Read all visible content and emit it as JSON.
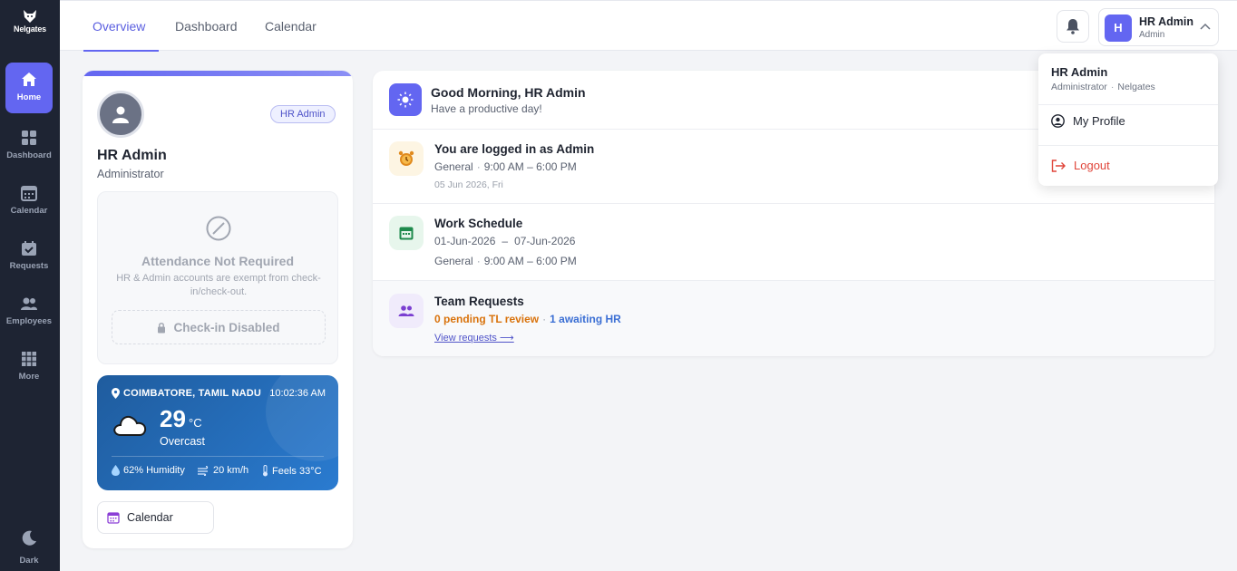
{
  "brand": {
    "name": "Nelgates"
  },
  "sidebar": {
    "items": [
      {
        "label": "Home",
        "icon": "home-icon",
        "active": true
      },
      {
        "label": "Dashboard",
        "icon": "grid-icon"
      },
      {
        "label": "Calendar",
        "icon": "calendar-icon"
      },
      {
        "label": "Requests",
        "icon": "requests-icon"
      },
      {
        "label": "Employees",
        "icon": "users-icon"
      },
      {
        "label": "More",
        "icon": "apps-icon"
      }
    ],
    "dark_label": "Dark"
  },
  "tabs": [
    {
      "label": "Overview",
      "active": true
    },
    {
      "label": "Dashboard"
    },
    {
      "label": "Calendar"
    }
  ],
  "user": {
    "initial": "H",
    "name": "HR Admin",
    "role": "Admin"
  },
  "profile": {
    "name": "HR Admin",
    "title": "Administrator",
    "badge": "HR Admin",
    "attendance_title": "Attendance Not Required",
    "attendance_desc": "HR & Admin accounts are exempt from check-in/check-out.",
    "checkin_label": "Check-in Disabled",
    "calendar_button": "Calendar"
  },
  "weather": {
    "location": "COIMBATORE, TAMIL NADU",
    "time": "10:02:36 AM",
    "temp": "29",
    "unit": "°C",
    "condition": "Overcast",
    "humidity": "62% Humidity",
    "wind": "20 km/h",
    "feels": "Feels 33°C"
  },
  "greeting": {
    "title": "Good Morning, HR Admin",
    "subtitle": "Have a productive day!"
  },
  "login": {
    "title": "You are logged in as Admin",
    "shift": "General",
    "hours": "9:00 AM – 6:00 PM",
    "date": "05 Jun 2026, Fri"
  },
  "schedule": {
    "title": "Work Schedule",
    "start": "01-Jun-2026",
    "end": "07-Jun-2026",
    "shift": "General",
    "hours": "9:00 AM – 6:00 PM"
  },
  "team": {
    "title": "Team Requests",
    "pending": "0 pending TL review",
    "awaiting": "1 awaiting HR",
    "link": "View requests ⟶"
  },
  "dropdown": {
    "name": "HR Admin",
    "title": "Administrator",
    "org": "Nelgates",
    "profile_label": "My Profile",
    "logout_label": "Logout"
  },
  "colors": {
    "accent": "#6366f1",
    "sidebar": "#1e2433",
    "logout": "#e0453a",
    "pending": "#d9730d",
    "awaiting": "#3b6fd4"
  }
}
